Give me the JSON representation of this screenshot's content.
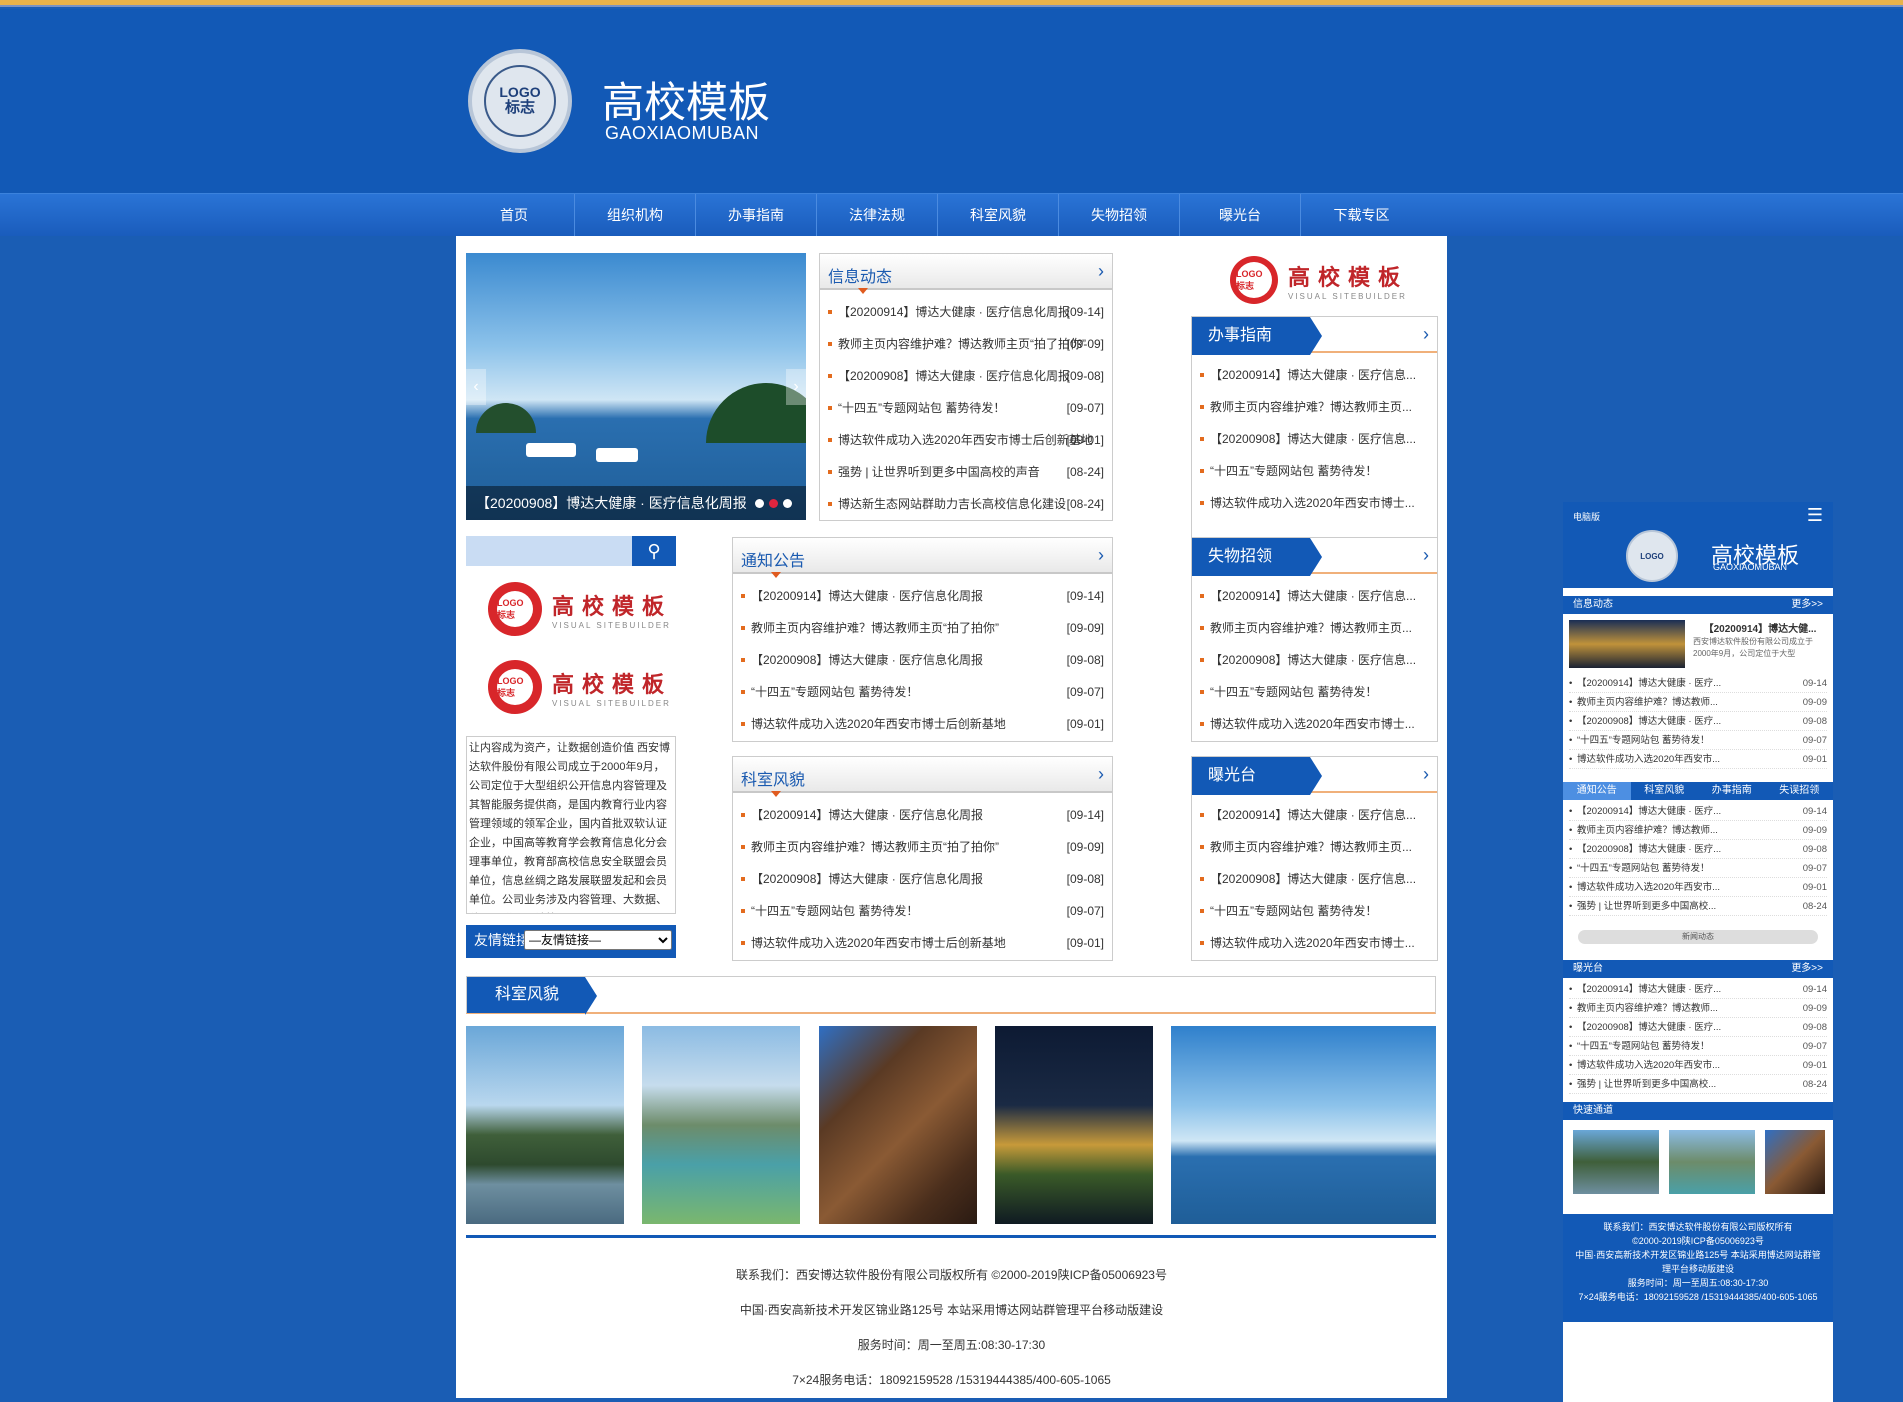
{
  "header": {
    "title": "高校模板",
    "subtitle": "GAOXIAOMUBAN",
    "logo_text_1": "LOGO",
    "logo_text_2": "标志"
  },
  "nav": [
    "首页",
    "组织机构",
    "办事指南",
    "法律法规",
    "科室风貌",
    "失物招领",
    "曝光台",
    "下载专区"
  ],
  "slider": {
    "caption": "【20200908】博达大健康 · 医疗信息化周报",
    "prev": "‹",
    "next": "›"
  },
  "news": {
    "title": "信息动态",
    "items": [
      {
        "t": "【20200914】博达大健康 · 医疗信息化周报",
        "d": "[09-14]"
      },
      {
        "t": "教师主页内容维护难？博达教师主页“拍了拍你”",
        "d": "[09-09]"
      },
      {
        "t": "【20200908】博达大健康 · 医疗信息化周报",
        "d": "[09-08]"
      },
      {
        "t": "“十四五”专题网站包 蓄势待发！",
        "d": "[09-07]"
      },
      {
        "t": "博达软件成功入选2020年西安市博士后创新基地",
        "d": "[09-01]"
      },
      {
        "t": "强势 | 让世界听到更多中国高校的声音",
        "d": "[08-24]"
      },
      {
        "t": "博达新生态网站群助力吉长高校信息化建设",
        "d": "[08-24]"
      }
    ]
  },
  "notice": {
    "title": "通知公告",
    "items": [
      {
        "t": "【20200914】博达大健康 · 医疗信息化周报",
        "d": "[09-14]"
      },
      {
        "t": "教师主页内容维护难？博达教师主页“拍了拍你”",
        "d": "[09-09]"
      },
      {
        "t": "【20200908】博达大健康 · 医疗信息化周报",
        "d": "[09-08]"
      },
      {
        "t": "“十四五”专题网站包 蓄势待发！",
        "d": "[09-07]"
      },
      {
        "t": "博达软件成功入选2020年西安市博士后创新基地",
        "d": "[09-01]"
      }
    ]
  },
  "dept": {
    "title": "科室风貌",
    "items": [
      {
        "t": "【20200914】博达大健康 · 医疗信息化周报",
        "d": "[09-14]"
      },
      {
        "t": "教师主页内容维护难？博达教师主页“拍了拍你”",
        "d": "[09-09]"
      },
      {
        "t": "【20200908】博达大健康 · 医疗信息化周报",
        "d": "[09-08]"
      },
      {
        "t": "“十四五”专题网站包 蓄势待发！",
        "d": "[09-07]"
      },
      {
        "t": "博达软件成功入选2020年西安市博士后创新基地",
        "d": "[09-01]"
      }
    ]
  },
  "side_logo": {
    "a": "高校模板",
    "b": "VISUAL SITEBUILDER",
    "c": "LOGO 标志"
  },
  "guide": {
    "title": "办事指南",
    "items": [
      "【20200914】博达大健康 · 医疗信息...",
      "教师主页内容维护难？博达教师主页...",
      "【20200908】博达大健康 · 医疗信息...",
      "“十四五”专题网站包 蓄势待发！",
      "博达软件成功入选2020年西安市博士..."
    ]
  },
  "lost": {
    "title": "失物招领",
    "items": [
      "【20200914】博达大健康 · 医疗信息...",
      "教师主页内容维护难？博达教师主页...",
      "【20200908】博达大健康 · 医疗信息...",
      "“十四五”专题网站包 蓄势待发！",
      "博达软件成功入选2020年西安市博士..."
    ]
  },
  "expose": {
    "title": "曝光台",
    "items": [
      "【20200914】博达大健康 · 医疗信息...",
      "教师主页内容维护难？博达教师主页...",
      "【20200908】博达大健康 · 医疗信息...",
      "“十四五”专题网站包 蓄势待发！",
      "博达软件成功入选2020年西安市博士..."
    ]
  },
  "intro": "让内容成为资产，让数据创造价值 西安博达软件股份有限公司成立于2000年9月，公司定位于大型组织公开信息内容管理及其智能服务提供商，是国内教育行业内容管理领域的领军企业，国内首批双软认证企业，中国高等教育学会教育信息化分会理事单位，教育部高校信息安全联盟会员单位，信息丝绸之路发展联盟发起和会员单位。公司业务涉及内容管理、大数据、移动互联、云计算...",
  "links": {
    "label": "友情链接:",
    "option": "—友情链接—"
  },
  "gallery_title": "科室风貌",
  "footer": [
    "联系我们：西安博达软件股份有限公司版权所有 ©2000-2019陕ICP备05006923号",
    "中国·西安高新技术开发区锦业路125号 本站采用博达网站群管理平台移动版建设",
    "服务时间：周一至周五:08:30-17:30",
    "7×24服务电话：18092159528 /15319444385/400-605-1065"
  ],
  "mobile": {
    "label": "电脑版",
    "title": "高校模板",
    "subtitle": "GAOXIAOMUBAN",
    "news_title": "信息动态",
    "more": "更多>>",
    "feature_title": "【20200914】博达大健...",
    "feature_desc": "西安博达软件股份有限公司成立于2000年9月，公司定位于大型",
    "news": [
      {
        "t": "【20200914】博达大健康 · 医疗...",
        "d": "09-14"
      },
      {
        "t": "教师主页内容维护难？博达教师...",
        "d": "09-09"
      },
      {
        "t": "【20200908】博达大健康 · 医疗...",
        "d": "09-08"
      },
      {
        "t": "“十四五”专题网站包 蓄势待发！",
        "d": "09-07"
      },
      {
        "t": "博达软件成功入选2020年西安市...",
        "d": "09-01"
      }
    ],
    "tabs": [
      "通知公告",
      "科室风貌",
      "办事指南",
      "失误招领"
    ],
    "tab_items": [
      {
        "t": "【20200914】博达大健康 · 医疗...",
        "d": "09-14"
      },
      {
        "t": "教师主页内容维护难？博达教师...",
        "d": "09-09"
      },
      {
        "t": "【20200908】博达大健康 · 医疗...",
        "d": "09-08"
      },
      {
        "t": "“十四五”专题网站包 蓄势待发！",
        "d": "09-07"
      },
      {
        "t": "博达软件成功入选2020年西安市...",
        "d": "09-01"
      },
      {
        "t": "强势 | 让世界听到更多中国高校...",
        "d": "08-24"
      }
    ],
    "tab_more": "新闻动态",
    "expose_title": "曝光台",
    "expose": [
      {
        "t": "【20200914】博达大健康 · 医疗...",
        "d": "09-14"
      },
      {
        "t": "教师主页内容维护难？博达教师...",
        "d": "09-09"
      },
      {
        "t": "【20200908】博达大健康 · 医疗...",
        "d": "09-08"
      },
      {
        "t": "“十四五”专题网站包 蓄势待发！",
        "d": "09-07"
      },
      {
        "t": "博达软件成功入选2020年西安市...",
        "d": "09-01"
      },
      {
        "t": "强势 | 让世界听到更多中国高校...",
        "d": "08-24"
      }
    ],
    "quick_title": "快速通道",
    "footer": [
      "联系我们：西安博达软件股份有限公司版权所有",
      "©2000-2019陕ICP备05006923号",
      "中国·西安高新技术开发区锦业路125号 本站采用博达网站群管理平台移动版建设",
      "服务时间：周一至周五:08:30-17:30",
      "7×24服务电话：18092159528 /15319444385/400-605-1065"
    ]
  }
}
